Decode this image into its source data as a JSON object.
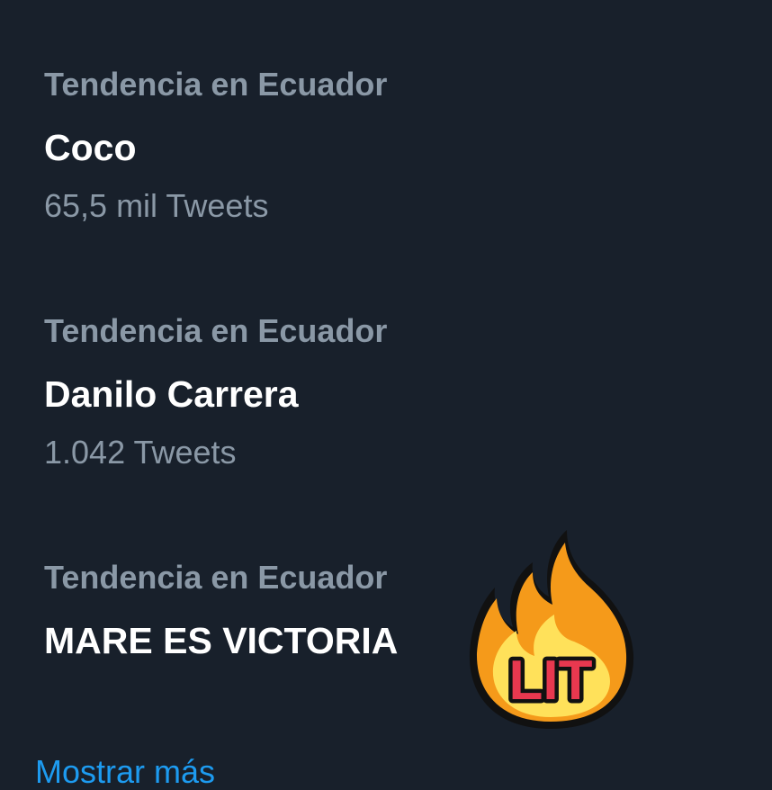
{
  "trends": [
    {
      "context": "Tendencia en Ecuador",
      "title": "Coco",
      "count": "65,5 mil Tweets"
    },
    {
      "context": "Tendencia en Ecuador",
      "title": "Danilo Carrera",
      "count": "1.042 Tweets"
    },
    {
      "context": "Tendencia en Ecuador",
      "title": "MARE ES VICTORIA"
    }
  ],
  "show_more": "Mostrar más",
  "sticker": {
    "icon": "fire-icon",
    "text": "LIT",
    "colors": {
      "flame_outer": "#f59a1a",
      "flame_inner": "#ffe15a",
      "text": "#e8384f"
    }
  },
  "colors": {
    "background": "#18202b",
    "muted_text": "#8a98a6",
    "primary_text": "#ffffff",
    "link": "#1d9bf0"
  }
}
